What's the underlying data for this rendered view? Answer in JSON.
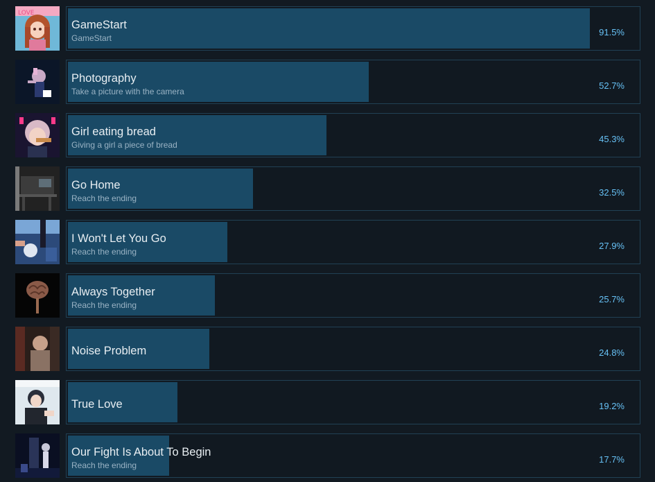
{
  "achievements": [
    {
      "title": "GameStart",
      "description": "GameStart",
      "percent_label": "91.5%",
      "percent": 91.5,
      "icon": "game-start-icon"
    },
    {
      "title": "Photography",
      "description": "Take a picture with the camera",
      "percent_label": "52.7%",
      "percent": 52.7,
      "icon": "photography-icon"
    },
    {
      "title": "Girl eating bread",
      "description": "Giving a girl a piece of bread",
      "percent_label": "45.3%",
      "percent": 45.3,
      "icon": "girl-eating-bread-icon"
    },
    {
      "title": "Go Home",
      "description": "Reach the ending",
      "percent_label": "32.5%",
      "percent": 32.5,
      "icon": "go-home-icon"
    },
    {
      "title": "I Won't Let You Go",
      "description": "Reach the ending",
      "percent_label": "27.9%",
      "percent": 27.9,
      "icon": "wont-let-you-go-icon"
    },
    {
      "title": "Always Together",
      "description": "Reach the ending",
      "percent_label": "25.7%",
      "percent": 25.7,
      "icon": "always-together-icon"
    },
    {
      "title": "Noise Problem",
      "description": "",
      "percent_label": "24.8%",
      "percent": 24.8,
      "icon": "noise-problem-icon"
    },
    {
      "title": "True Love",
      "description": "",
      "percent_label": "19.2%",
      "percent": 19.2,
      "icon": "true-love-icon"
    },
    {
      "title": "Our Fight Is About To Begin",
      "description": "Reach the ending",
      "percent_label": "17.7%",
      "percent": 17.7,
      "icon": "our-fight-icon"
    }
  ],
  "colors": {
    "background": "#121a22",
    "bar_fill": "#1a4a66",
    "bar_border": "#214155",
    "percent_text": "#67c1f5",
    "title_text": "#e8eef2",
    "desc_text": "#9ab3c4"
  }
}
